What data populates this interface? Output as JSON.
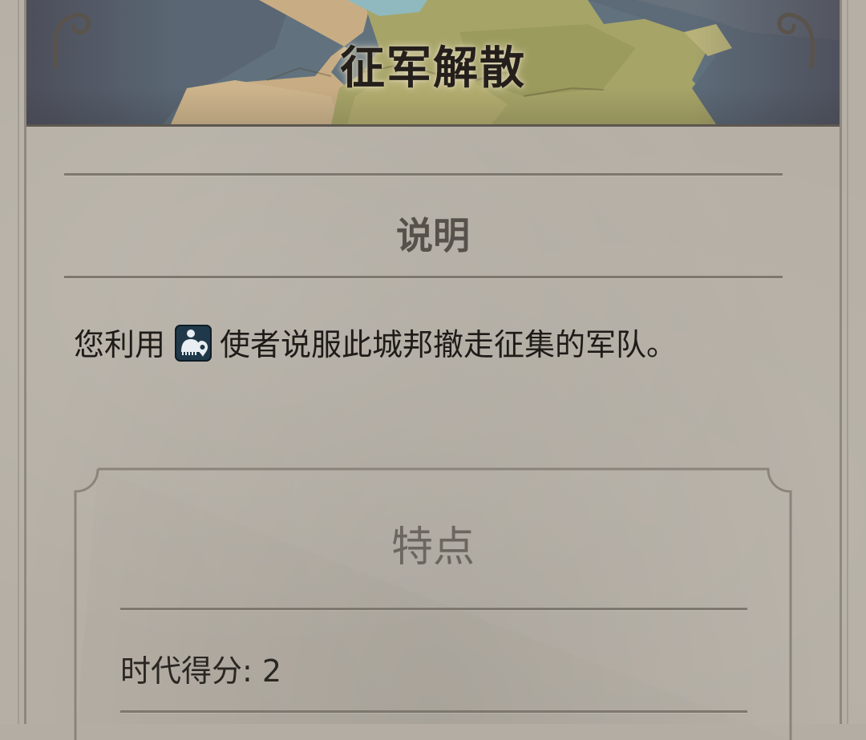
{
  "header": {
    "title": "征军解散"
  },
  "description": {
    "heading": "说明",
    "text_before_icon": "您利用",
    "icon": "envoy-icon",
    "text_after_icon": "使者说服此城邦撤走征集的军队。"
  },
  "features": {
    "heading": "特点",
    "era_score_label": "时代得分:",
    "era_score_value": "2"
  },
  "colors": {
    "title": "#241f1b",
    "heading": "#56514a",
    "parchment": "#b5afa5",
    "icon_bg": "#20394a"
  }
}
